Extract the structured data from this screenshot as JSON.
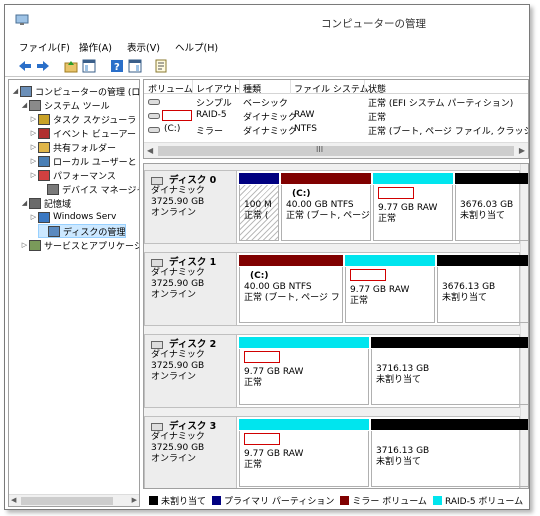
{
  "window": {
    "title": "コンピューターの管理"
  },
  "menu": [
    "ファイル(F)",
    "操作(A)",
    "表示(V)",
    "ヘルプ(H)"
  ],
  "tree": {
    "items": [
      {
        "label": "コンピューターの管理 (ロー",
        "icon": "computer-icon"
      },
      {
        "label": "システム ツール",
        "icon": "tools-icon"
      },
      {
        "label": "タスク スケジューラ",
        "icon": "clock-icon"
      },
      {
        "label": "イベント ビューアー",
        "icon": "event-viewer-icon"
      },
      {
        "label": "共有フォルダー",
        "icon": "shared-folder-icon"
      },
      {
        "label": "ローカル ユーザーと",
        "icon": "users-icon"
      },
      {
        "label": "パフォーマンス",
        "icon": "performance-icon"
      },
      {
        "label": "デバイス マネージャ",
        "icon": "device-manager-icon"
      },
      {
        "label": "記憶域",
        "icon": "storage-icon"
      },
      {
        "label": "Windows Serv",
        "icon": "windows-server-backup-icon"
      },
      {
        "label": "ディスクの管理",
        "icon": "disk-management-icon"
      },
      {
        "label": "サービスとアプリケーショ",
        "icon": "services-icon"
      }
    ]
  },
  "volumes": {
    "columns": [
      "ボリューム",
      "レイアウト",
      "種類",
      "ファイル システム",
      "状態"
    ],
    "rows": [
      {
        "volume": "",
        "layout": "シンプル",
        "type": "ベーシック",
        "fs": "",
        "status": "正常 (EFI システム パーティション)"
      },
      {
        "volume": "",
        "layout": "RAID-5",
        "type": "ダイナミック",
        "fs": "RAW",
        "status": "正常"
      },
      {
        "volume": "(C:)",
        "layout": "ミラー",
        "type": "ダイナミック",
        "fs": "NTFS",
        "status": "正常 (ブート, ページ ファイル, クラッシュ ダン"
      }
    ],
    "scroll_grip": "III"
  },
  "disks": [
    {
      "name": "ディスク 0",
      "type": "ダイナミック",
      "size": "3725.90 GB",
      "status": "オンライン",
      "partitions": [
        {
          "label": "",
          "line1": "100 M",
          "line2": "正常 (",
          "kind": "primary"
        },
        {
          "label": "(C:)",
          "line1": "40.00 GB NTFS",
          "line2": "正常 (ブート, ページ",
          "kind": "mirror"
        },
        {
          "label": "",
          "line1": "9.77 GB RAW",
          "line2": "正常",
          "kind": "raid5"
        },
        {
          "label": "",
          "line1": "3676.03 GB",
          "line2": "未割り当て",
          "kind": "unallocated"
        }
      ]
    },
    {
      "name": "ディスク 1",
      "type": "ダイナミック",
      "size": "3725.90 GB",
      "status": "オンライン",
      "partitions": [
        {
          "label": "(C:)",
          "line1": "40.00 GB NTFS",
          "line2": "正常 (ブート, ページ フ",
          "kind": "mirror"
        },
        {
          "label": "",
          "line1": "9.77 GB RAW",
          "line2": "正常",
          "kind": "raid5"
        },
        {
          "label": "",
          "line1": "3676.13 GB",
          "line2": "未割り当て",
          "kind": "unallocated"
        }
      ]
    },
    {
      "name": "ディスク 2",
      "type": "ダイナミック",
      "size": "3725.90 GB",
      "status": "オンライン",
      "partitions": [
        {
          "label": "",
          "line1": "9.77 GB RAW",
          "line2": "正常",
          "kind": "raid5"
        },
        {
          "label": "",
          "line1": "3716.13 GB",
          "line2": "未割り当て",
          "kind": "unallocated"
        }
      ]
    },
    {
      "name": "ディスク 3",
      "type": "ダイナミック",
      "size": "3725.90 GB",
      "status": "オンライン",
      "partitions": [
        {
          "label": "",
          "line1": "9.77 GB RAW",
          "line2": "正常",
          "kind": "raid5"
        },
        {
          "label": "",
          "line1": "3716.13 GB",
          "line2": "未割り当て",
          "kind": "unallocated"
        }
      ]
    }
  ],
  "legend": [
    {
      "label": "未割り当て",
      "color": "#000000"
    },
    {
      "label": "プライマリ パーティション",
      "color": "#000080"
    },
    {
      "label": "ミラー ボリューム",
      "color": "#800000"
    },
    {
      "label": "RAID-5 ボリューム",
      "color": "#00e5ee"
    }
  ],
  "colors": {
    "unallocated": "#000000",
    "primary": "#000080",
    "mirror": "#800000",
    "raid5": "#00e5ee"
  }
}
